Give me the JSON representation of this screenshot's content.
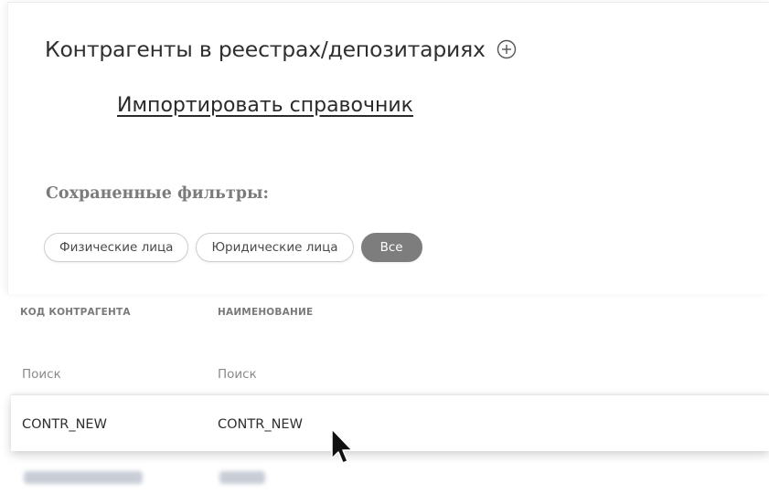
{
  "header": {
    "title": "Контрагенты в реестрах/депозитариях",
    "add_icon": "plus-circle-icon",
    "import_link": "Импортировать справочник"
  },
  "filters": {
    "label": "Сохраненные фильтры:",
    "chips": [
      "Физические лица",
      "Юридические лица",
      "Все"
    ],
    "active": "Все",
    "active_color": "#7d7d7d"
  },
  "table": {
    "columns": [
      "КОД КОНТРАГЕНТА",
      "НАИМЕНОВАНИЕ"
    ],
    "search_placeholders": [
      "Поиск",
      "Поиск"
    ],
    "rows": [
      [
        "CONTR_NEW",
        "CONTR_NEW"
      ]
    ]
  },
  "cursor_icon": "mouse-pointer-icon"
}
